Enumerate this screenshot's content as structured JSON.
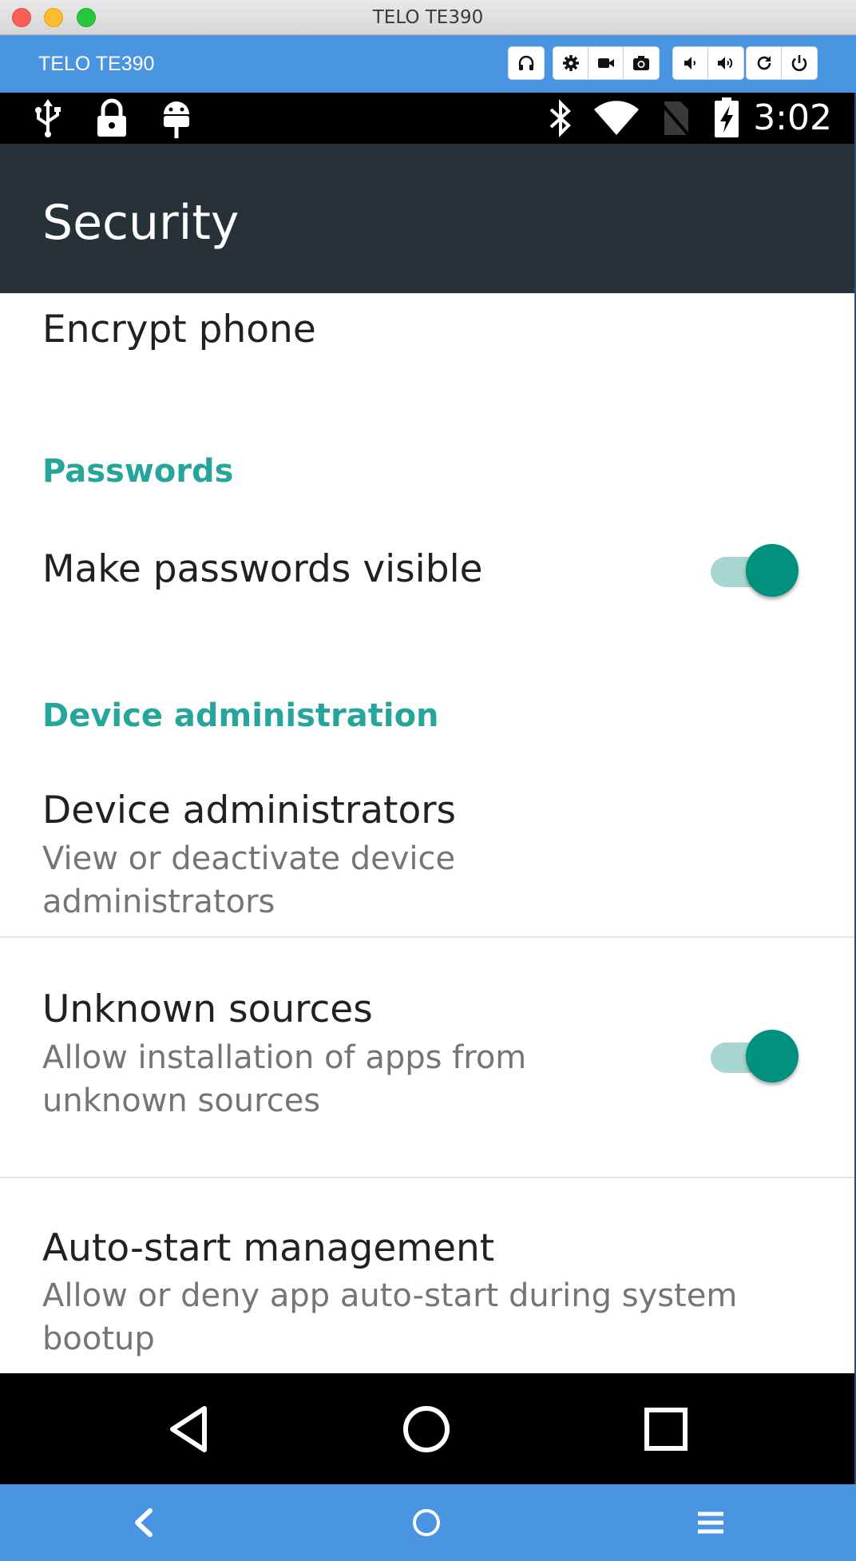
{
  "window": {
    "title": "TELO TE390"
  },
  "toolbar": {
    "device_name": "TELO TE390",
    "buttons": [
      {
        "name": "headphones-icon"
      },
      {
        "name": "gear-icon"
      },
      {
        "name": "video-camera-icon"
      },
      {
        "name": "camera-icon"
      },
      {
        "name": "volume-down-icon"
      },
      {
        "name": "volume-up-icon"
      },
      {
        "name": "rotate-icon"
      },
      {
        "name": "power-icon"
      }
    ]
  },
  "status_bar": {
    "left_icons": [
      "usb-icon",
      "lock-icon",
      "android-debug-icon"
    ],
    "right_icons": [
      "bluetooth-icon",
      "wifi-icon",
      "no-sim-icon",
      "battery-charging-icon"
    ],
    "time": "3:02"
  },
  "app_bar": {
    "title": "Security"
  },
  "settings": {
    "encrypt_phone": {
      "title": "Encrypt phone"
    },
    "passwords_header": "Passwords",
    "make_passwords_visible": {
      "title": "Make passwords visible",
      "enabled": true
    },
    "device_admin_header": "Device administration",
    "device_administrators": {
      "title": "Device administrators",
      "summary": "View or deactivate device administrators"
    },
    "unknown_sources": {
      "title": "Unknown sources",
      "summary": "Allow installation of apps from unknown sources",
      "enabled": true
    },
    "auto_start": {
      "title": "Auto-start management",
      "summary": "Allow or deny app auto-start during system bootup"
    }
  },
  "nav_bar": {
    "buttons": [
      "back-icon",
      "home-icon",
      "recents-icon"
    ]
  },
  "bottom_bar": {
    "buttons": [
      "chevron-left-icon",
      "circle-icon",
      "menu-icon"
    ]
  },
  "colors": {
    "toolbar": "#4a95e2",
    "app_bar": "#263238",
    "accent": "#00907e",
    "section_header": "#26a69a"
  }
}
